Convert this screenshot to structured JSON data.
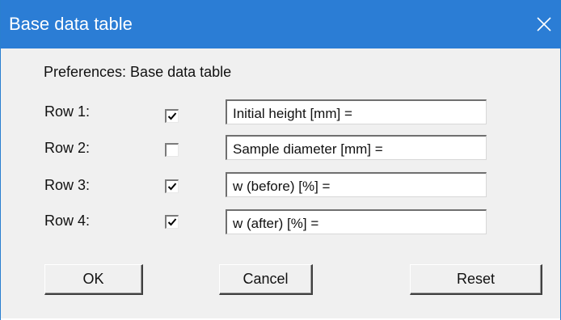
{
  "window": {
    "title": "Base data table"
  },
  "preferences_label": "Preferences: Base data table",
  "rows": [
    {
      "label": "Row 1:",
      "checked": true,
      "value": "Initial height [mm] ="
    },
    {
      "label": "Row 2:",
      "checked": false,
      "value": "Sample diameter [mm] ="
    },
    {
      "label": "Row 3:",
      "checked": true,
      "value": "w (before) [%] ="
    },
    {
      "label": "Row 4:",
      "checked": true,
      "value": "w (after) [%] ="
    }
  ],
  "buttons": {
    "ok": "OK",
    "cancel": "Cancel",
    "reset": "Reset"
  },
  "icons": {
    "close": "close-icon",
    "check": "checkmark-icon"
  },
  "colors": {
    "titlebar": "#2b7dd5",
    "dialog_bg": "#f0f0f0"
  }
}
